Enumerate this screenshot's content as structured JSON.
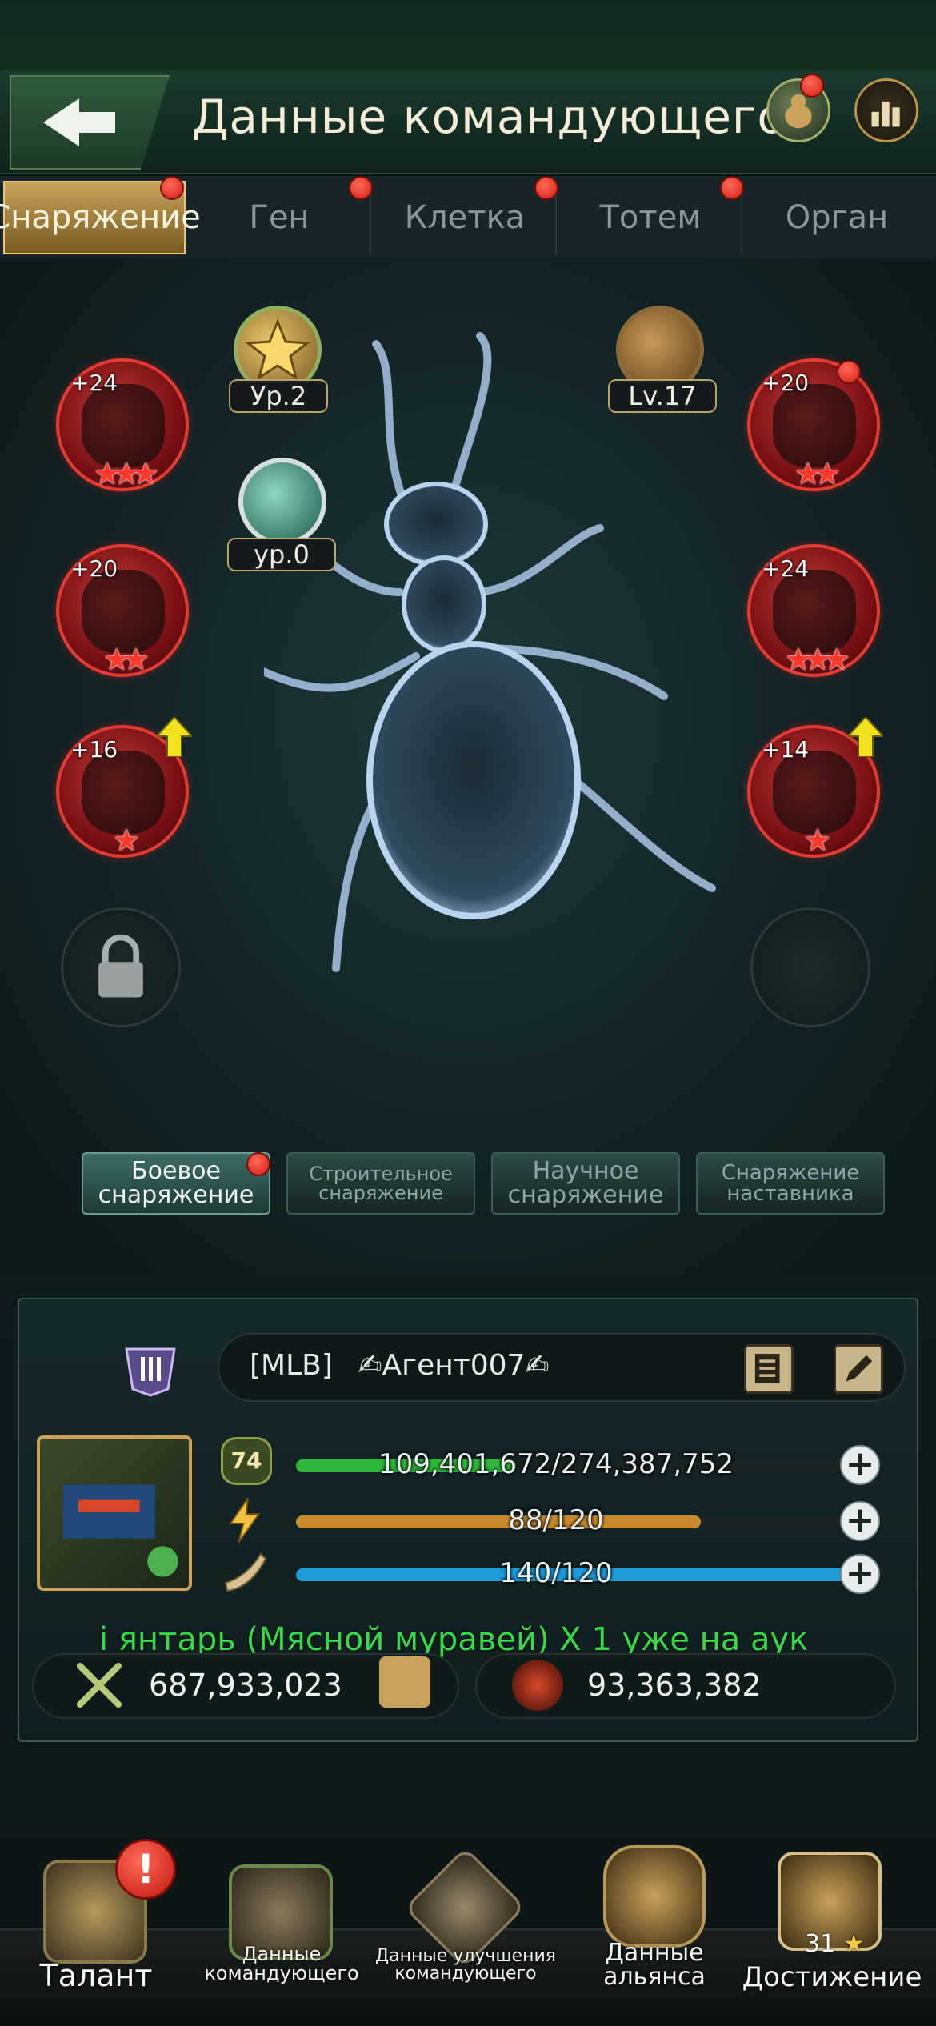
{
  "header": {
    "title": "Данные командующего",
    "back_icon": "back-arrow-icon",
    "ant_icon": "ant-badge-icon",
    "chart_icon": "bar-chart-icon"
  },
  "tabs": [
    {
      "label": "Снаряжение",
      "active": true
    },
    {
      "label": "Ген",
      "active": false
    },
    {
      "label": "Клетка",
      "active": false
    },
    {
      "label": "Тотем",
      "active": false
    },
    {
      "label": "Орган",
      "active": false
    }
  ],
  "medals": {
    "star_level": "Ур.2",
    "shield_level": "ур.0",
    "ant_level": "Lv.17"
  },
  "gear_slots": {
    "left": [
      {
        "plus": "+24",
        "stars": "★★★"
      },
      {
        "plus": "+20",
        "stars": "★★"
      },
      {
        "plus": "+16",
        "stars": "★"
      }
    ],
    "right": [
      {
        "plus": "+20",
        "stars": "★★"
      },
      {
        "plus": "+24",
        "stars": "★★★"
      },
      {
        "plus": "+14",
        "stars": "★"
      }
    ]
  },
  "gear_types": [
    {
      "line1": "Боевое",
      "line2": "снаряжение"
    },
    {
      "line1": "Строительное",
      "line2": "снаряжение"
    },
    {
      "line1": "Научное",
      "line2": "снаряжение"
    },
    {
      "line1": "Снаряжение",
      "line2": "наставника"
    }
  ],
  "player": {
    "tag": "[MLB]",
    "name": "✍Агент007✍",
    "level": "74",
    "exp": "109,401,672/274,387,752",
    "exp_fraction": 0.399,
    "energy": "88/120",
    "energy_fraction": 0.733,
    "stamina": "140/120",
    "stamina_fraction": 1.0,
    "marquee": "і янтарь (Мясной муравей) X 1 уже на аук",
    "power": "687,933,023",
    "kills": "93,363,382"
  },
  "colors": {
    "exp_bar": "#2eb83a",
    "energy_bar": "#c98a2e",
    "stamina_bar": "#1e9bd8",
    "marquee": "#35d94a",
    "notify": "#e2251a"
  },
  "nav": [
    {
      "label": "Талант",
      "icon": "talent-icon"
    },
    {
      "label": "Данные командующего",
      "icon": "commander-icon"
    },
    {
      "label": "Данные улучшения командующего",
      "icon": "upgrade-icon"
    },
    {
      "label": "Данные альянса",
      "icon": "alliance-icon"
    },
    {
      "label": "Достижение",
      "icon": "achievement-icon",
      "count": "31"
    }
  ]
}
